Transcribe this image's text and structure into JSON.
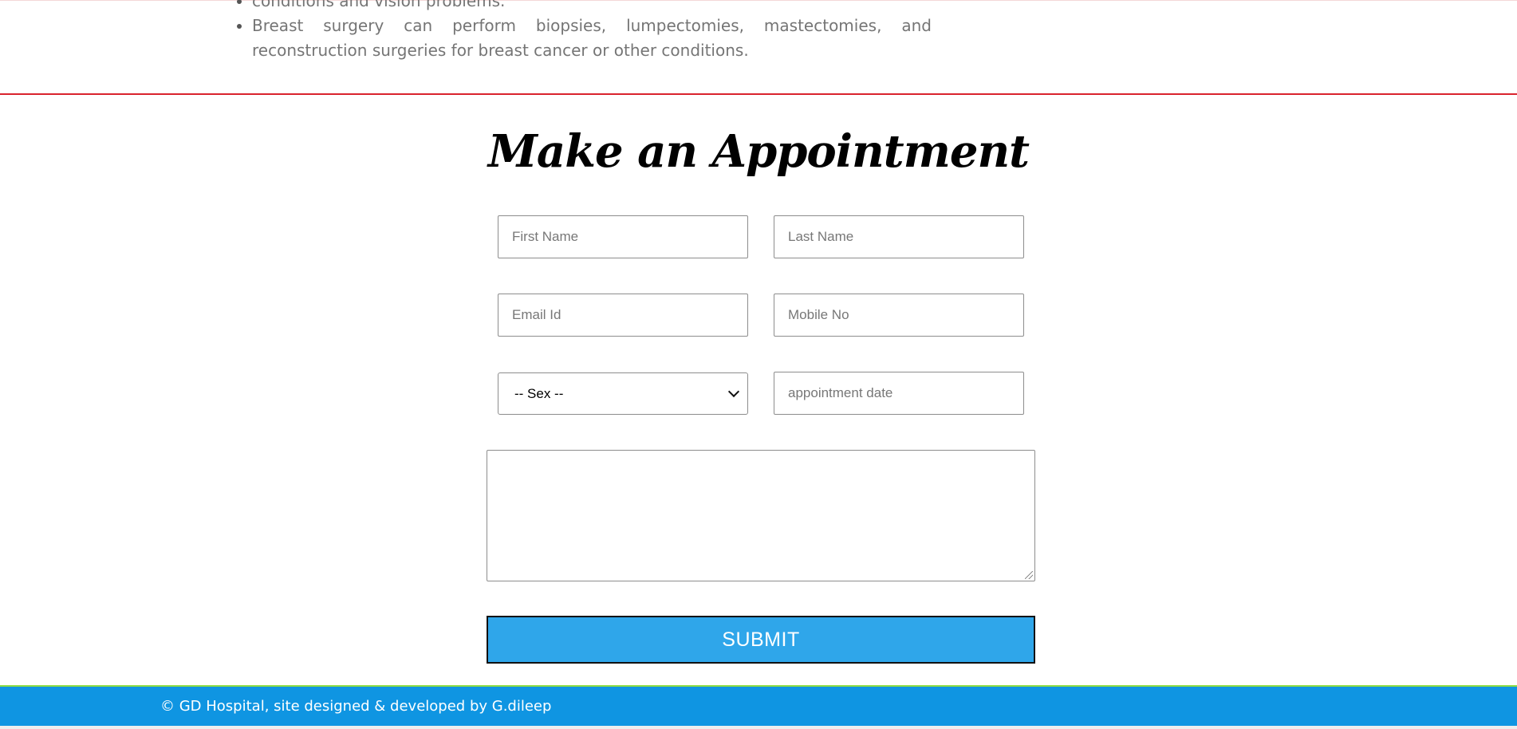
{
  "services": {
    "items": [
      {
        "lines": [
          "conditions and vision problems."
        ]
      },
      {
        "lines": [
          "Breast surgery can perform biopsies, lumpectomies, mastectomies, and",
          "reconstruction surgeries for breast cancer or other conditions."
        ]
      }
    ]
  },
  "appointment": {
    "title": "Make an Appointment",
    "fields": {
      "first_name": {
        "placeholder": "First Name",
        "value": ""
      },
      "last_name": {
        "placeholder": "Last Name",
        "value": ""
      },
      "email": {
        "placeholder": "Email Id",
        "value": ""
      },
      "mobile": {
        "placeholder": "Mobile No",
        "value": ""
      },
      "sex": {
        "selected": "-- Sex --"
      },
      "date": {
        "placeholder": "appointment date",
        "value": ""
      },
      "message": {
        "value": ""
      }
    },
    "submit_label": "SUBMIT"
  },
  "footer": {
    "text": "© GD Hospital, site designed & developed by G.dileep"
  },
  "colors": {
    "divider": "#d9232d",
    "submit": "#2fa6ea",
    "footer": "#0f95e2",
    "footer_top_line": "#8ddc43"
  }
}
